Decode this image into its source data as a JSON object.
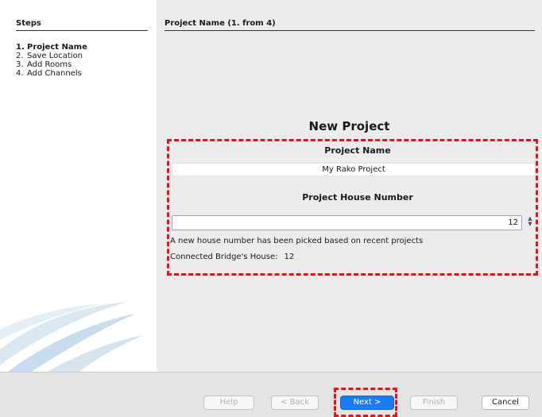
{
  "steps": {
    "heading": "Steps",
    "items": [
      {
        "num": "1.",
        "label": "Project Name"
      },
      {
        "num": "2.",
        "label": "Save Location"
      },
      {
        "num": "3.",
        "label": "Add Rooms"
      },
      {
        "num": "4.",
        "label": "Add Channels"
      }
    ]
  },
  "page": {
    "heading": "Project Name (1. from 4)",
    "title": "New Project"
  },
  "form": {
    "project_name_label": "Project Name",
    "project_name_value": "My Rako Project",
    "house_number_label": "Project House Number",
    "house_number_value": "12",
    "note": "A new house number has been picked based on recent projects",
    "bridge_label": "Connected Bridge's House:",
    "bridge_value": "12"
  },
  "buttons": {
    "help": "Help",
    "back": "< Back",
    "next": "Next >",
    "finish": "Finish",
    "cancel": "Cancel"
  },
  "colors": {
    "highlight": "#e8101a",
    "primary_button": "#1a7cf5"
  },
  "icons": {
    "spinner": "up-down-spinner-icon",
    "watermark": "swoosh-logo-watermark"
  }
}
